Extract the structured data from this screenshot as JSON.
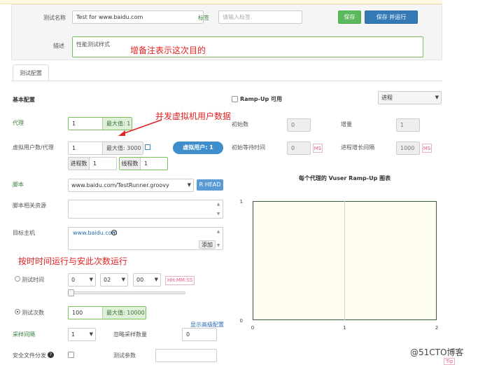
{
  "top": {
    "test_name_label": "测试名称",
    "test_name_value": "Test for www.baidu.com",
    "tag_label": "标签",
    "tag_placeholder": "请输入标签.",
    "save_label": "保存",
    "save_run_label": "保存 并运行",
    "desc_label": "描述",
    "desc_value": "性能测试样式"
  },
  "annotations": {
    "desc_note": "增备注表示这次目的",
    "vuser_note": "并发虚拟机用户数据",
    "run_mode_note": "按时时间运行与安此次数运行"
  },
  "tabs": [
    {
      "label": "测试配置"
    }
  ],
  "basic": {
    "title": "基本配置",
    "agent_label": "代理",
    "agent_value": "1",
    "agent_max": "最大值: 1",
    "vuser_label": "虚拟用户数/代理",
    "vuser_value": "1",
    "vuser_max": "最大值: 3000",
    "process_label": "进程数",
    "process_value": "1",
    "thread_label": "线程数",
    "thread_value": "1",
    "vuser_pill": "虚拟用户: 1",
    "script_label": "脚本",
    "script_value": "www.baidu.com/TestRunner.groovy",
    "rhead_label": "R HEAD",
    "resource_label": "脚本相关资源",
    "target_label": "目标主机",
    "target_value": "www.baidu.com",
    "add_label": "添加",
    "duration_label": "测试时间",
    "hours": "0",
    "minutes": "02",
    "seconds": "00",
    "time_format": "HH:MM:SS",
    "runcount_label": "测试次数",
    "runcount_value": "100",
    "runcount_max": "最大值: 10000",
    "advanced_link": "显示高级配置",
    "sampling_label": "采样间隔",
    "sampling_value": "1",
    "ignore_label": "忽略采样数量",
    "ignore_value": "0",
    "safe_dist_label": "安全文件分发",
    "test_params_label": "测试参数"
  },
  "rampup": {
    "toggle_label": "Ramp-Up 可用",
    "mode_value": "进程",
    "initial_label": "初始数",
    "initial_value": "0",
    "increment_label": "增量",
    "increment_value": "1",
    "init_wait_label": "初始等待时间",
    "init_wait_value": "0",
    "interval_label": "进程增长间隔",
    "interval_value": "1000",
    "ms": "MS"
  },
  "chart_data": {
    "type": "line",
    "title": "每个代理的 Vuser Ramp-Up 图表",
    "x_ticks": [
      "0",
      "1",
      "2"
    ],
    "y_ticks": [
      "0",
      "1"
    ],
    "xlim": [
      0,
      2
    ],
    "ylim": [
      0,
      1
    ],
    "series": []
  },
  "footer": {
    "watermark": "@51CTO博客",
    "tip": "Tip"
  }
}
